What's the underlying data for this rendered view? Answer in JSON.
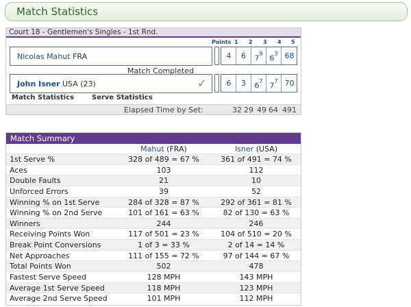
{
  "header": {
    "title": "Match Statistics"
  },
  "scoreboard": {
    "court_line": "Court 18 - Gentlemen's Singles - 1st Rnd.",
    "col_points": "Points",
    "col_sets": [
      "1",
      "2",
      "3",
      "4",
      "5"
    ],
    "status": "Match Completed",
    "players": [
      {
        "name": "Nicolas Mahut",
        "country": " FRA",
        "seed": "",
        "sets": [
          {
            "games": "4",
            "tb": ""
          },
          {
            "games": "6",
            "tb": ""
          },
          {
            "games": "7",
            "tb": "9"
          },
          {
            "games": "6",
            "tb": "3"
          },
          {
            "games": "68",
            "tb": ""
          }
        ]
      },
      {
        "name": "John Isner",
        "country": " USA (23)",
        "seed": "(23)",
        "winner": true,
        "sets": [
          {
            "games": "6",
            "tb": ""
          },
          {
            "games": "3",
            "tb": ""
          },
          {
            "games": "6",
            "tb": "7"
          },
          {
            "games": "7",
            "tb": "7"
          },
          {
            "games": "70",
            "tb": ""
          }
        ]
      }
    ],
    "links": {
      "match_stats": "Match Statistics",
      "serve_stats": "Serve Statistics"
    },
    "elapsed_label": "Elapsed Time by Set:",
    "elapsed_values": [
      "32",
      "29",
      "49",
      "64",
      "491"
    ]
  },
  "summary": {
    "title": "Match Summary",
    "p1_head": "Mahut",
    "p1_country": "(FRA)",
    "p2_head": "Isner",
    "p2_country": "(USA)",
    "rows": [
      {
        "label": "1st Serve %",
        "v1": "328 of 489 = 67 %",
        "v2": "361 of 491 = 74 %"
      },
      {
        "label": "Aces",
        "v1": "103",
        "v2": "112"
      },
      {
        "label": "Double Faults",
        "v1": "21",
        "v2": "10"
      },
      {
        "label": "Unforced Errors",
        "v1": "39",
        "v2": "52"
      },
      {
        "label": "Winning % on 1st Serve",
        "v1": "284 of 328 = 87 %",
        "v2": "292 of 361 = 81 %"
      },
      {
        "label": "Winning % on 2nd Serve",
        "v1": "101 of 161 = 63 %",
        "v2": "82 of 130 = 63 %"
      },
      {
        "label": "Winners",
        "v1": "244",
        "v2": "246"
      },
      {
        "label": "Receiving Points Won",
        "v1": "117 of 501 = 23 %",
        "v2": "104 of 510 = 20 %"
      },
      {
        "label": "Break Point Conversions",
        "v1": "1 of 3 = 33 %",
        "v2": "2 of 14 = 14 %"
      },
      {
        "label": "Net Approaches",
        "v1": "111 of 155 = 72 %",
        "v2": "97 of 144 = 67 %"
      },
      {
        "label": "Total Points Won",
        "v1": "502",
        "v2": "478"
      },
      {
        "label": " Fastest Serve Speed",
        "v1": "128 MPH",
        "v2": "143 MPH"
      },
      {
        "label": " Average 1st Serve Speed",
        "v1": "118 MPH",
        "v2": "123 MPH"
      },
      {
        "label": " Average 2nd Serve Speed",
        "v1": "101 MPH",
        "v2": "112 MPH"
      }
    ]
  },
  "colors": {
    "header_green": "#2a6a2a",
    "purple": "#603c8a",
    "link_blue": "#1a4f8a"
  },
  "icons": {
    "winner": "check-icon"
  }
}
